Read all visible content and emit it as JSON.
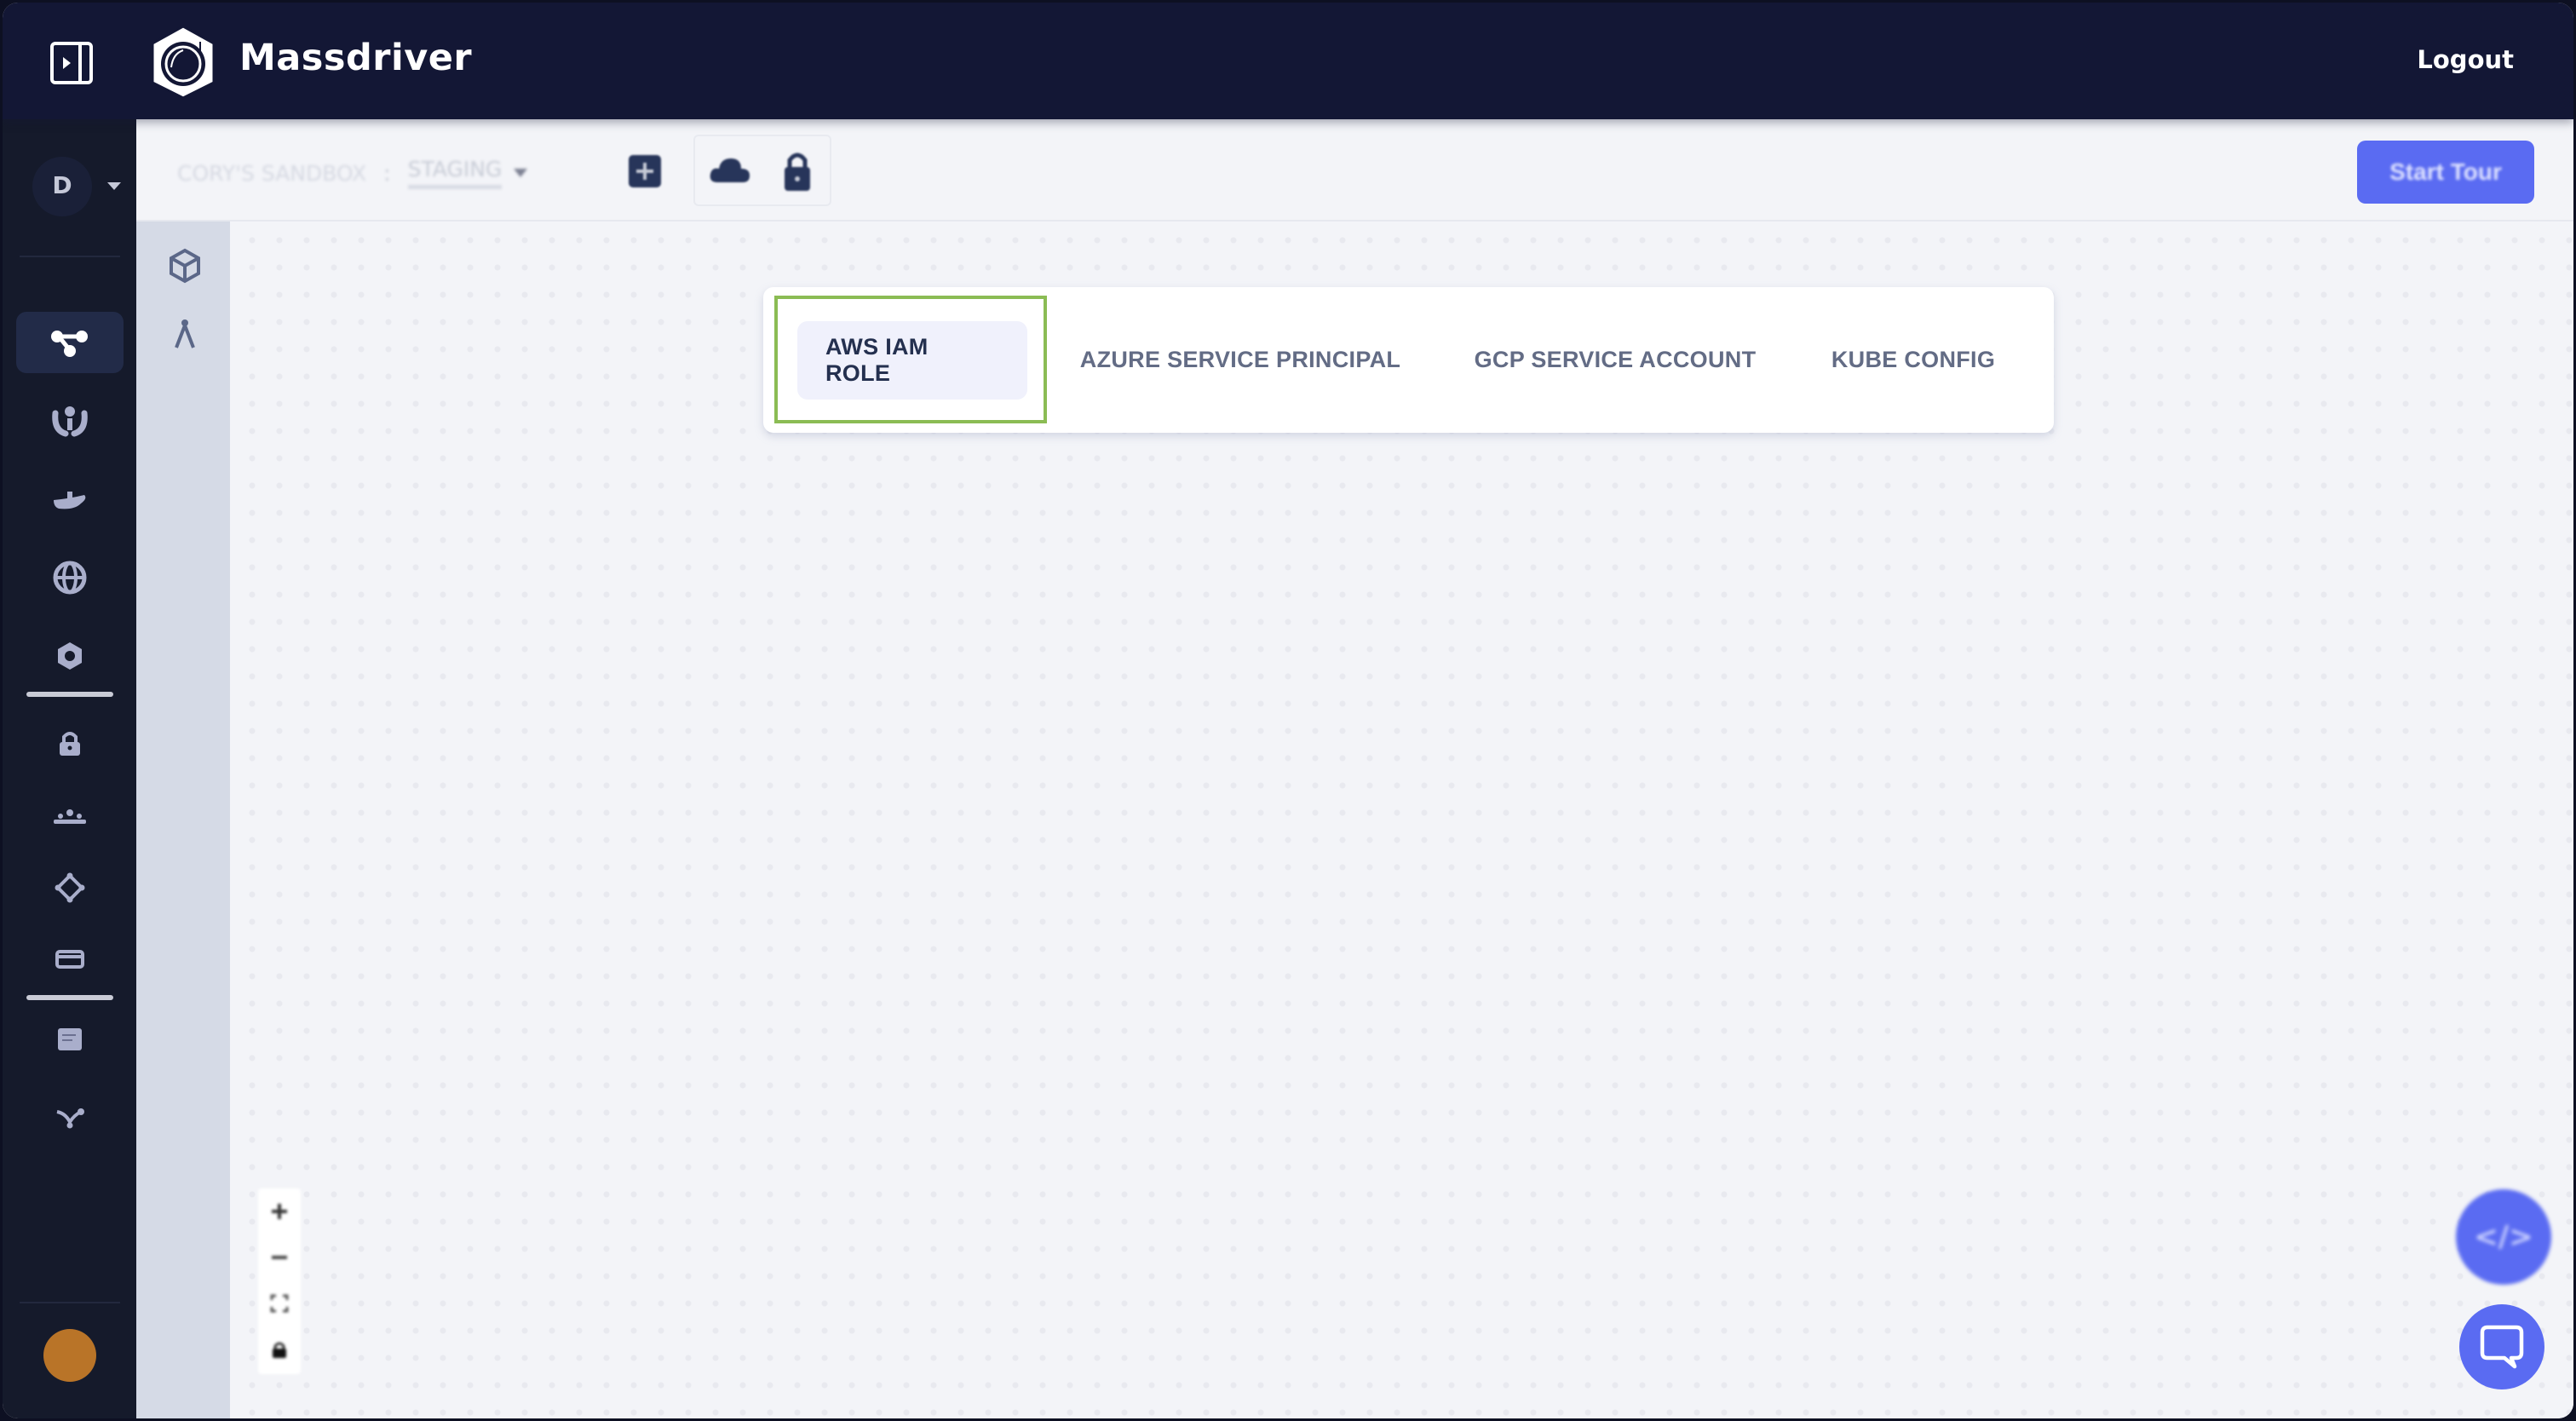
{
  "header": {
    "brand": "Massdriver",
    "logout_label": "Logout",
    "collapse_icon": "sidebar-toggle-icon",
    "logo_icon": "astronaut-helmet-logo"
  },
  "sidebar": {
    "org_initial": "D",
    "items": [
      {
        "icon": "graph-nodes-icon",
        "active": true
      },
      {
        "icon": "people-group-icon",
        "active": false
      },
      {
        "icon": "docker-whale-icon",
        "active": false
      },
      {
        "icon": "globe-icon",
        "active": false
      },
      {
        "icon": "gear-icon",
        "active": false
      },
      {
        "icon": "lock-icon",
        "active": false
      },
      {
        "icon": "team-icon",
        "active": false
      },
      {
        "icon": "diamond-nodes-icon",
        "active": false
      },
      {
        "icon": "credit-card-icon",
        "active": false
      },
      {
        "icon": "docs-icon",
        "active": false
      },
      {
        "icon": "branch-icon",
        "active": false
      }
    ],
    "avatar_color": "#b97428"
  },
  "toolbar": {
    "breadcrumb": {
      "project": "CORY'S SANDBOX",
      "separator": ":",
      "environment": "STAGING"
    },
    "tools": [
      "add-bundle-icon",
      "cloud-icon",
      "lock-icon"
    ],
    "start_tour_label": "Start Tour"
  },
  "rail": {
    "items": [
      "cube-icon",
      "compass-icon"
    ]
  },
  "credential_tabs": {
    "active_index": 0,
    "tabs": [
      {
        "label": "AWS IAM ROLE"
      },
      {
        "label": "AZURE SERVICE PRINCIPAL"
      },
      {
        "label": "GCP SERVICE ACCOUNT"
      },
      {
        "label": "KUBE CONFIG"
      }
    ]
  },
  "canvas_controls": {
    "zoom_in": "+",
    "zoom_out": "−",
    "fit_view": "fit-view-icon",
    "lock": "lock-icon"
  },
  "fab": {
    "label": "</>"
  },
  "colors": {
    "header_bg": "#131735",
    "sidebar_bg": "#151a2b",
    "accent": "#5a6bf2",
    "highlight": "#8bbc54",
    "active_tab_bg": "#f0f1fc"
  }
}
